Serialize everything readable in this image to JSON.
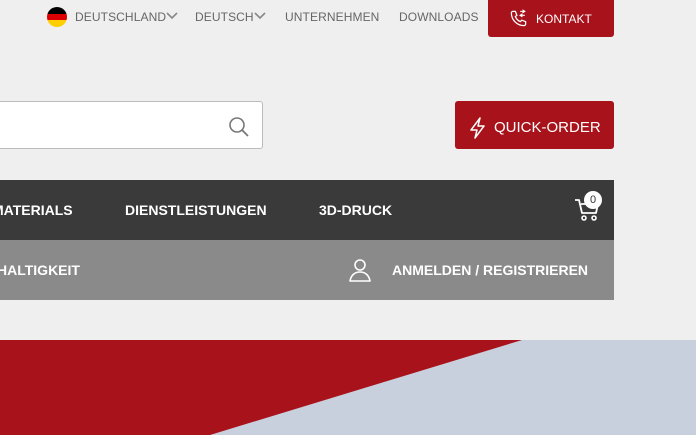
{
  "topbar": {
    "country": "DEUTSCHLAND",
    "language": "DEUTSCH",
    "company": "UNTERNEHMEN",
    "downloads": "DOWNLOADS",
    "contact": "KONTAKT",
    "flag_icon": "germany-flag-icon",
    "contact_icon": "phone-transfer-icon"
  },
  "search": {
    "value": "",
    "placeholder": "",
    "icon": "search-icon"
  },
  "quick_order": {
    "label": "QUICK-ORDER",
    "icon": "lightning-icon"
  },
  "main_nav": {
    "items": [
      {
        "label": "MATERIALS"
      },
      {
        "label": "DIENSTLEISTUNGEN"
      },
      {
        "label": "3D-DRUCK"
      }
    ],
    "cart_icon": "shopping-cart-icon",
    "cart_count": "0"
  },
  "sub_nav": {
    "items": [
      {
        "label": "HALTIGKEIT"
      }
    ],
    "account_icon": "user-icon",
    "account_label": "ANMELDEN / REGISTRIEREN"
  },
  "colors": {
    "brand_red": "#a8121b",
    "nav_dark": "#3a3a3a",
    "nav_gray": "#8a8a8a",
    "hero_blue": "#c9d0dd"
  }
}
